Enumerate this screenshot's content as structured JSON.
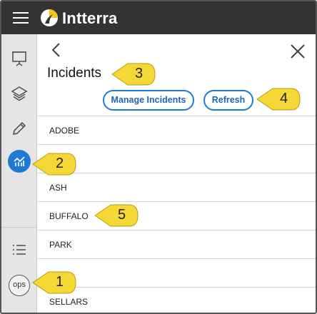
{
  "app": {
    "brand": "Intterra"
  },
  "sidebar": {
    "items": [
      {
        "icon": "presentation-icon"
      },
      {
        "icon": "layers-icon"
      },
      {
        "icon": "pencil-icon"
      },
      {
        "icon": "chart-icon",
        "active": true
      },
      {
        "icon": "list-icon"
      }
    ],
    "user_badge": "ops"
  },
  "panel": {
    "title": "Incidents",
    "manage_button": "Manage Incidents",
    "refresh_button": "Refresh",
    "incidents": [
      "ADOBE",
      "",
      "ASH",
      "BUFFALO",
      "PARK",
      "",
      "SELLARS"
    ]
  },
  "callouts": [
    "1",
    "2",
    "3",
    "4",
    "5"
  ],
  "colors": {
    "accent": "#1f7bd1",
    "callout": "#f5d735",
    "topbar": "#333333",
    "sidebar": "#e5e5e5"
  }
}
